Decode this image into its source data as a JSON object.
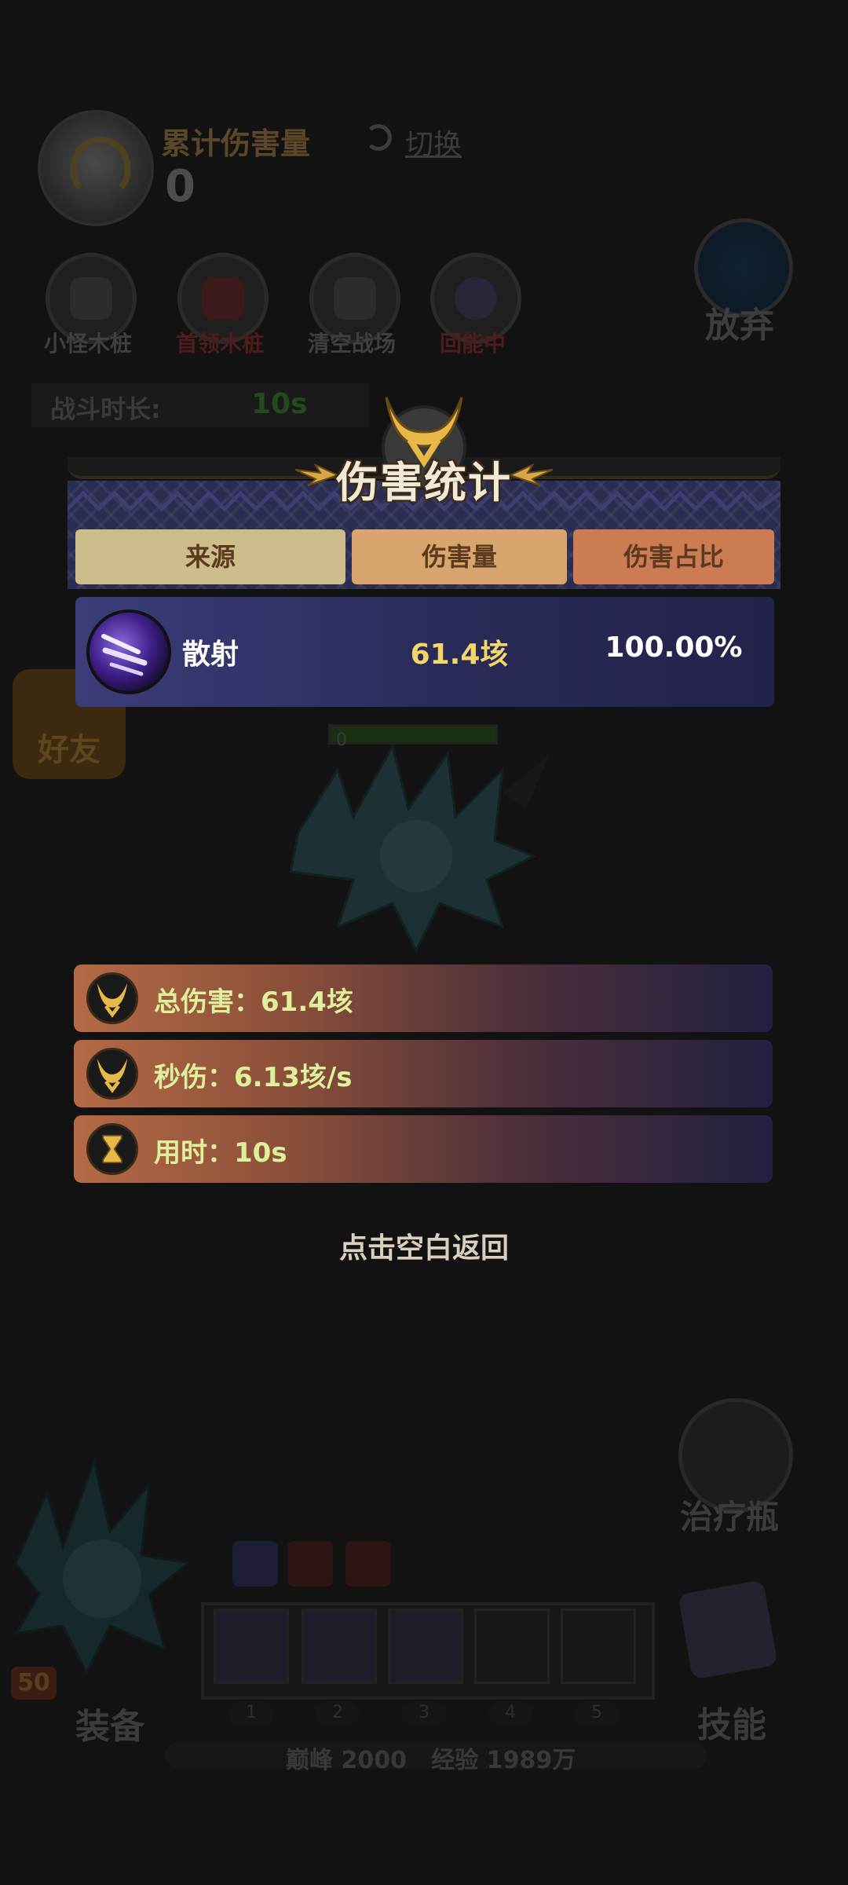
{
  "hud": {
    "cumulative_damage_label": "累计伤害量",
    "cumulative_damage_value": "0",
    "switch_label": "切换",
    "giveup_label": "放弃",
    "battle_duration_label": "战斗时长:",
    "battle_duration_value": "10s",
    "friend_label": "好友",
    "monster_hp_value": "0",
    "heal_label": "治疗瓶",
    "equip_label": "装备",
    "skill_label": "技能",
    "hero_level": "50",
    "exp_text": "巅峰 2000   经验 1989万"
  },
  "mode_buttons": [
    {
      "label": "小怪木桩"
    },
    {
      "label": "首领木桩"
    },
    {
      "label": "清空战场"
    },
    {
      "label": "回能中"
    }
  ],
  "skill_slots": {
    "numbers": [
      "1",
      "2",
      "3",
      "4",
      "5"
    ]
  },
  "dialog": {
    "title": "伤害统计",
    "columns": {
      "source": "来源",
      "damage": "伤害量",
      "percent": "伤害占比"
    },
    "rows": [
      {
        "source": "散射",
        "damage": "61.4垓",
        "percent": "100.00%",
        "icon": "scatter-shot-icon"
      }
    ],
    "summary": {
      "total": "总伤害：61.4垓",
      "dps": "秒伤：6.13垓/s",
      "time": "用时：10s"
    },
    "back_hint": "点击空白返回"
  },
  "colors": {
    "header_source": "#ccbd8b",
    "header_damage": "#d8a56e",
    "header_percent": "#cc7c53",
    "damage_value": "#f3d66a",
    "summary_text": "#dff09a"
  }
}
